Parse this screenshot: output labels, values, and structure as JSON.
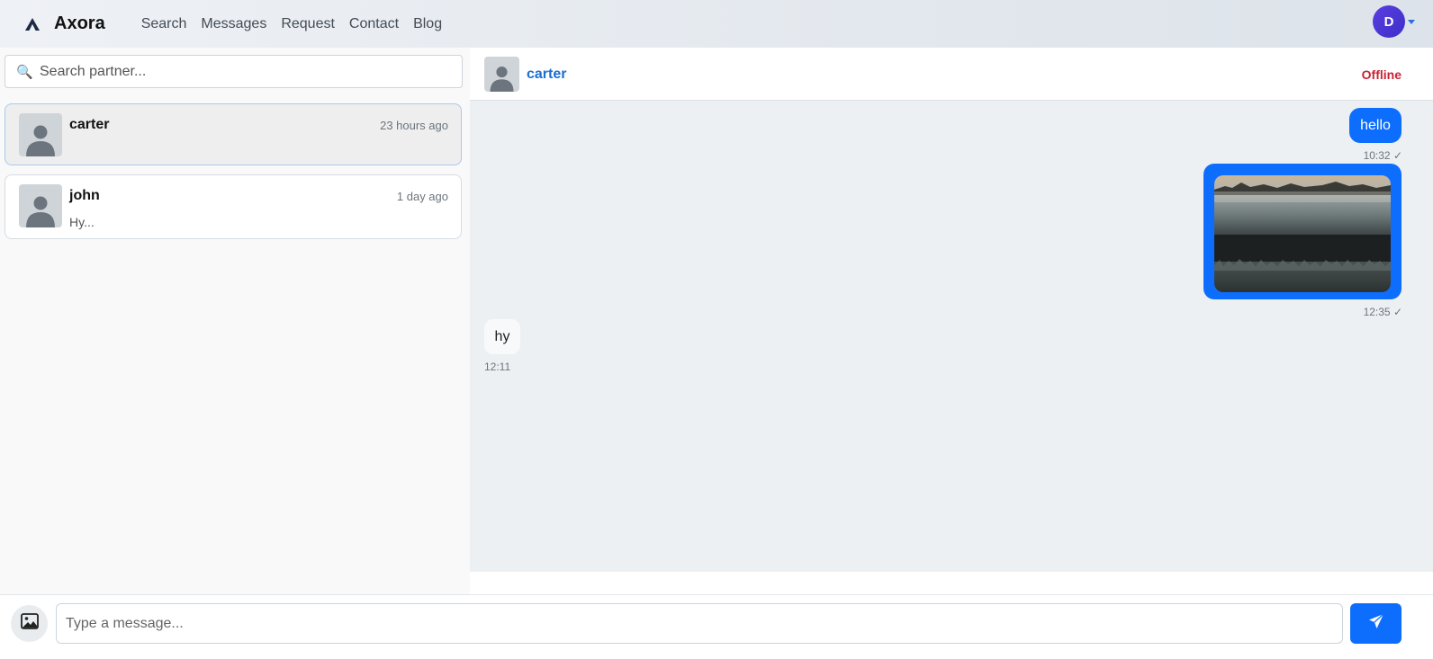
{
  "brand": {
    "name": "Axora",
    "icon": "triangle-logo-icon"
  },
  "nav": {
    "links": [
      "Search",
      "Messages",
      "Request",
      "Contact",
      "Blog"
    ]
  },
  "user": {
    "initial": "D"
  },
  "sidebar": {
    "search_placeholder": "Search partner...",
    "search_icon": "🔍",
    "conversations": [
      {
        "name": "carter",
        "time": "23 hours ago",
        "preview": "",
        "active": true
      },
      {
        "name": "john",
        "time": "1 day ago",
        "preview": "Hy...",
        "active": false
      }
    ]
  },
  "chat": {
    "partner": "carter",
    "status": "Offline",
    "messages": [
      {
        "direction": "out",
        "type": "text",
        "text": "hello",
        "time": "10:32 ✓"
      },
      {
        "direction": "out",
        "type": "image",
        "time": "12:35 ✓"
      },
      {
        "direction": "in",
        "type": "text",
        "text": "hy",
        "time": "12:11"
      }
    ]
  },
  "composer": {
    "placeholder": "Type a message..."
  },
  "colors": {
    "primary": "#0d6efd",
    "offline": "#c82333",
    "link": "#1a6fd0"
  }
}
